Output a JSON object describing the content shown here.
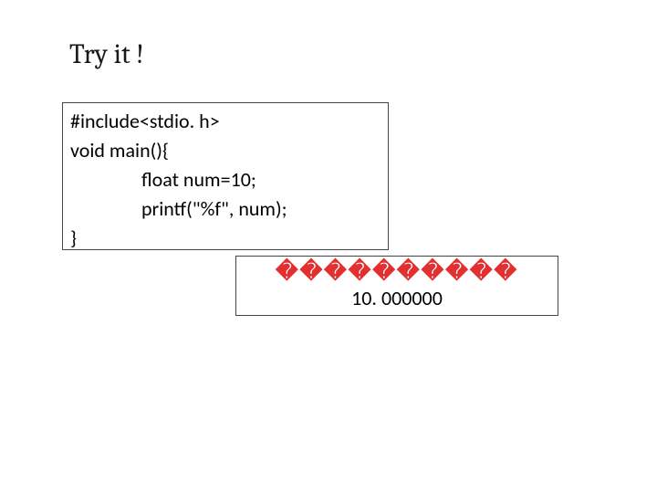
{
  "title": "Try it !",
  "code": {
    "l1": "#include<stdio. h>",
    "l2": "void main(){",
    "l3": "float num=10;",
    "l4": "printf(\"%f\", num);",
    "l5": "}"
  },
  "result": {
    "placeholder": "����������",
    "value": "10. 000000"
  }
}
